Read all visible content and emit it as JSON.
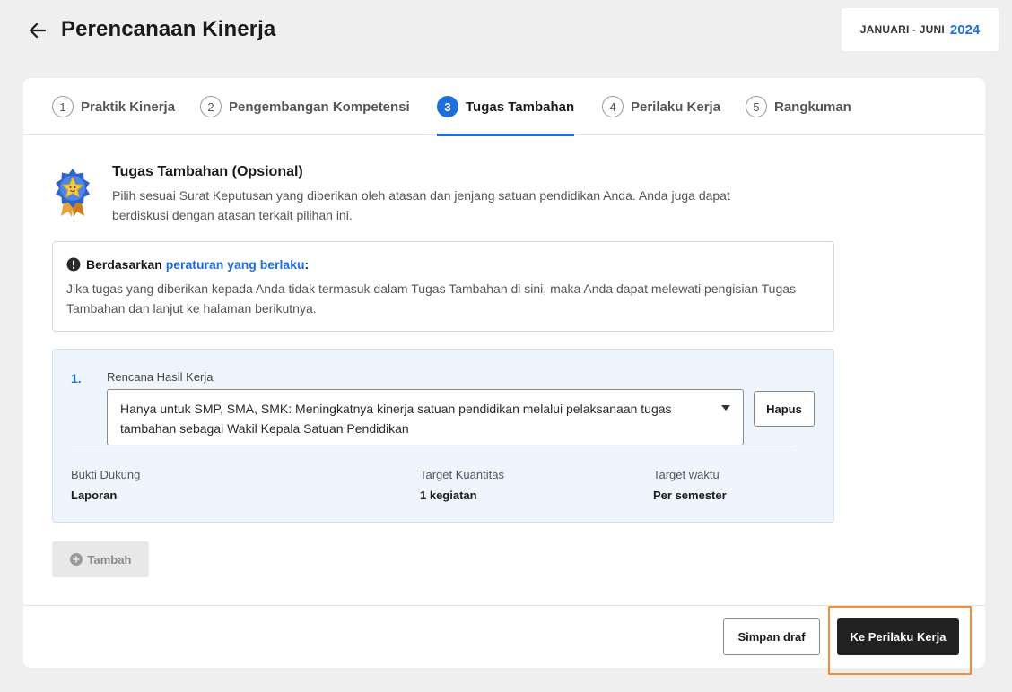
{
  "header": {
    "title": "Perencanaan Kinerja",
    "period_label": "JANUARI - JUNI",
    "period_year": "2024",
    "back_icon": "arrow-left-icon"
  },
  "tabs": [
    {
      "number": "1",
      "label": "Praktik Kinerja",
      "active": false
    },
    {
      "number": "2",
      "label": "Pengembangan Kompetensi",
      "active": false
    },
    {
      "number": "3",
      "label": "Tugas Tambahan",
      "active": true
    },
    {
      "number": "4",
      "label": "Perilaku Kerja",
      "active": false
    },
    {
      "number": "5",
      "label": "Rangkuman",
      "active": false
    }
  ],
  "intro": {
    "title": "Tugas Tambahan (Opsional)",
    "description": "Pilih sesuai Surat Keputusan yang diberikan oleh atasan dan jenjang satuan pendidikan Anda. Anda juga dapat berdiskusi dengan atasan terkait pilihan ini.",
    "icon": "medal-star-icon"
  },
  "info": {
    "prefix": "Berdasarkan ",
    "link": "peraturan yang berlaku",
    "suffix": ":",
    "text": "Jika tugas yang diberikan kepada Anda tidak termasuk dalam Tugas Tambahan di sini, maka Anda dapat melewati pengisian Tugas Tambahan dan lanjut ke halaman berikutnya.",
    "icon": "alert-circle-icon"
  },
  "plan": {
    "number": "1.",
    "field_label": "Rencana Hasil Kerja",
    "selected_value": "Hanya untuk SMP, SMA, SMK: Meningkatnya kinerja satuan pendidikan melalui pelaksanaan tugas tambahan sebagai Wakil Kepala Satuan Pendidikan",
    "delete_label": "Hapus",
    "meta": [
      {
        "label": "Bukti Dukung",
        "value": "Laporan"
      },
      {
        "label": "Target Kuantitas",
        "value": "1 kegiatan"
      },
      {
        "label": "Target waktu",
        "value": "Per semester"
      }
    ]
  },
  "add_label": "Tambah",
  "footer": {
    "draft_label": "Simpan draf",
    "next_label": "Ke Perilaku Kerja"
  },
  "colors": {
    "accent": "#1e6fd9",
    "highlight": "#f28c38",
    "primary_button": "#222222"
  }
}
